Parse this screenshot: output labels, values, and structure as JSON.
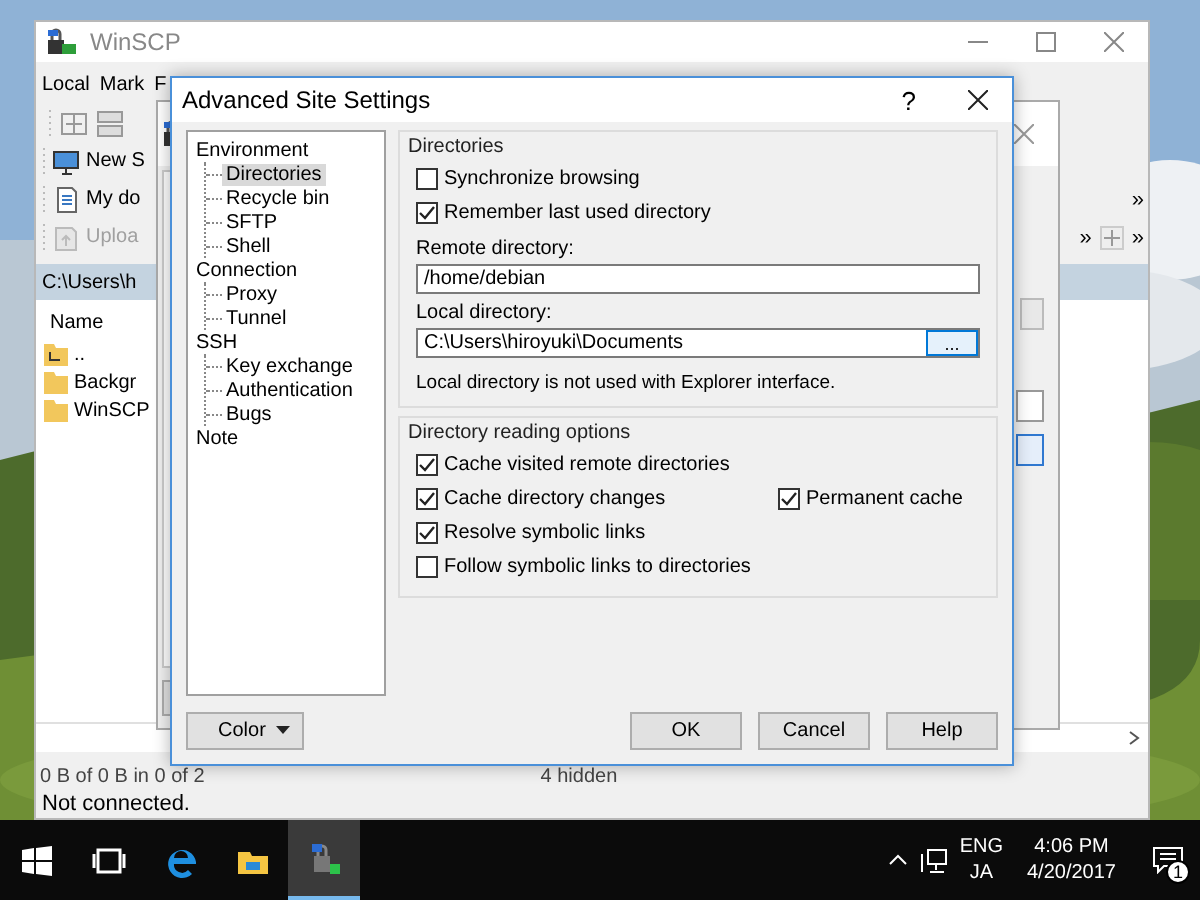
{
  "main_window": {
    "title": "WinSCP",
    "menu": [
      "Local",
      "Mark",
      "F"
    ],
    "toolbar_rows": [
      {
        "label": "New S",
        "kind": "computer",
        "disabled": false,
        "right": []
      },
      {
        "label": "My do",
        "kind": "document",
        "disabled": false,
        "right": [
          {
            "kind": "text",
            "text": "»"
          }
        ]
      },
      {
        "label": "Uploa",
        "kind": "upload",
        "disabled": true,
        "right": [
          {
            "kind": "text",
            "text": "»"
          },
          {
            "kind": "add"
          },
          {
            "kind": "text",
            "text": "»"
          }
        ]
      }
    ],
    "path": "C:\\Users\\h",
    "file_list": {
      "column": "Name",
      "items": [
        {
          "name": "..",
          "kind": "parent"
        },
        {
          "name": "Backgr",
          "kind": "folder"
        },
        {
          "name": "WinSCP",
          "kind": "folder"
        }
      ]
    },
    "status": {
      "summary": "0 B of 0 B in 0 of 2",
      "hidden": "4 hidden",
      "connection": "Not connected."
    }
  },
  "dialog": {
    "title": "Advanced Site Settings",
    "help": "?",
    "tree": [
      {
        "label": "Environment",
        "selected": false,
        "children": [
          {
            "label": "Directories",
            "selected": true
          },
          {
            "label": "Recycle bin",
            "selected": false
          },
          {
            "label": "SFTP",
            "selected": false
          },
          {
            "label": "Shell",
            "selected": false
          }
        ]
      },
      {
        "label": "Connection",
        "selected": false,
        "children": [
          {
            "label": "Proxy",
            "selected": false
          },
          {
            "label": "Tunnel",
            "selected": false
          }
        ]
      },
      {
        "label": "SSH",
        "selected": false,
        "children": [
          {
            "label": "Key exchange",
            "selected": false
          },
          {
            "label": "Authentication",
            "selected": false
          },
          {
            "label": "Bugs",
            "selected": false
          }
        ]
      },
      {
        "label": "Note",
        "selected": false
      }
    ],
    "groups": [
      {
        "title": "Directories",
        "items": [
          {
            "kind": "checkbox",
            "label": "Synchronize browsing",
            "checked": false
          },
          {
            "kind": "checkbox",
            "label": "Remember last used directory",
            "checked": true
          },
          {
            "kind": "field",
            "label": "Remote directory:",
            "value": "/home/debian"
          },
          {
            "kind": "field",
            "label": "Local directory:",
            "value": "C:\\Users\\hiroyuki\\Documents",
            "button": "..."
          },
          {
            "kind": "note",
            "text": "Local directory is not used with Explorer interface."
          }
        ]
      },
      {
        "title": "Directory reading options",
        "items": [
          {
            "kind": "checkbox",
            "label": "Cache visited remote directories",
            "checked": true
          },
          {
            "kind": "pair",
            "checkboxes": [
              {
                "label": "Cache directory changes",
                "checked": true
              },
              {
                "label": "Permanent cache",
                "checked": true
              }
            ]
          },
          {
            "kind": "checkbox",
            "label": "Resolve symbolic links",
            "checked": true
          },
          {
            "kind": "checkbox",
            "label": "Follow symbolic links to directories",
            "checked": false
          }
        ]
      }
    ],
    "color_button": "Color",
    "buttons": [
      "OK",
      "Cancel",
      "Help"
    ]
  },
  "taskbar": {
    "apps": [
      {
        "kind": "start",
        "selected": false
      },
      {
        "kind": "taskview",
        "selected": false
      },
      {
        "kind": "browser",
        "selected": false
      },
      {
        "kind": "files",
        "selected": false
      },
      {
        "kind": "winscp",
        "selected": true
      }
    ],
    "tray": {
      "language": "ENG",
      "ime": "JA",
      "time": "4:06 PM",
      "date": "4/20/2017",
      "notifications": "1"
    }
  }
}
